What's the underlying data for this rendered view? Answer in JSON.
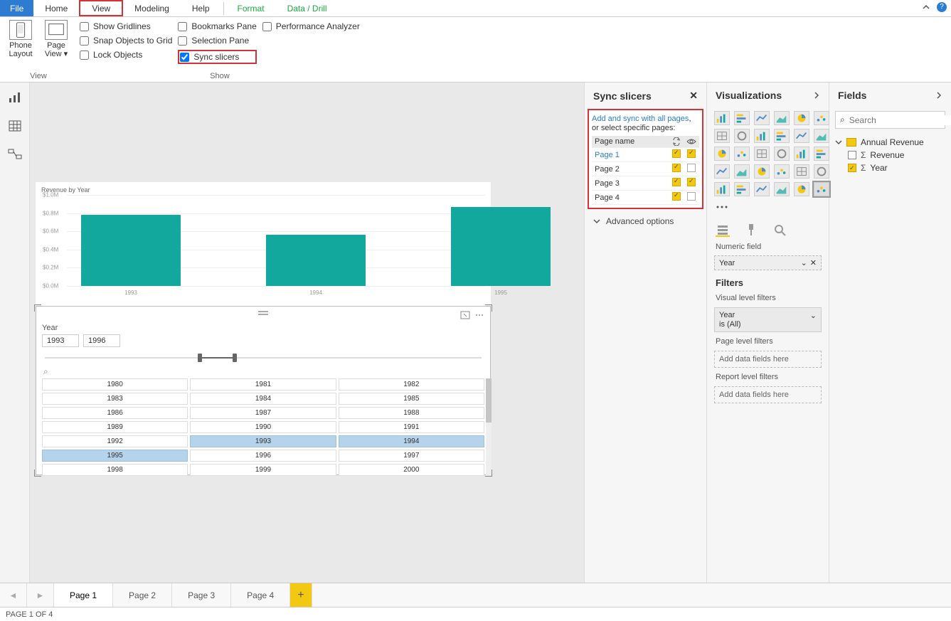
{
  "menu": {
    "file": "File",
    "home": "Home",
    "view": "View",
    "modeling": "Modeling",
    "help": "Help",
    "format": "Format",
    "datadrill": "Data / Drill"
  },
  "ribbon": {
    "view_group": "View",
    "show_group": "Show",
    "phone_layout": "Phone Layout",
    "page_view": "Page View",
    "show_gridlines": "Show Gridlines",
    "snap_to_grid": "Snap Objects to Grid",
    "lock_objects": "Lock Objects",
    "bookmarks_pane": "Bookmarks Pane",
    "selection_pane": "Selection Pane",
    "sync_slicers": "Sync slicers",
    "performance_analyzer": "Performance Analyzer"
  },
  "sync_pane": {
    "title": "Sync slicers",
    "msg1": "Add and sync with all pages",
    "msg1b": ",",
    "msg2": "or select specific pages:",
    "col_page": "Page name",
    "rows": [
      {
        "name": "Page 1",
        "sync": true,
        "visible": true,
        "active": true
      },
      {
        "name": "Page 2",
        "sync": true,
        "visible": false,
        "active": false
      },
      {
        "name": "Page 3",
        "sync": true,
        "visible": true,
        "active": false
      },
      {
        "name": "Page 4",
        "sync": true,
        "visible": false,
        "active": false
      }
    ],
    "advanced": "Advanced options"
  },
  "viz_pane": {
    "title": "Visualizations",
    "numeric_field": "Numeric field",
    "field_value": "Year"
  },
  "filters": {
    "title": "Filters",
    "visual_level": "Visual level filters",
    "card_field": "Year",
    "card_cond": "is (All)",
    "page_level": "Page level filters",
    "report_level": "Report level filters",
    "add_here": "Add data fields here"
  },
  "fields_pane": {
    "title": "Fields",
    "search_ph": "Search",
    "table": "Annual Revenue",
    "cols": [
      {
        "name": "Revenue",
        "checked": false
      },
      {
        "name": "Year",
        "checked": true
      }
    ]
  },
  "slicer": {
    "title": "Year",
    "from": "1993",
    "to": "1996",
    "years": [
      "1980",
      "1981",
      "1982",
      "1983",
      "1984",
      "1985",
      "1986",
      "1987",
      "1988",
      "1989",
      "1990",
      "1991",
      "1992",
      "1993",
      "1994",
      "1995",
      "1996",
      "1997",
      "1998",
      "1999",
      "2000"
    ],
    "selected": [
      "1993",
      "1994",
      "1995"
    ]
  },
  "chart_data": {
    "type": "bar",
    "title": "Revenue by Year",
    "categories": [
      "1993",
      "1994",
      "1995"
    ],
    "values": [
      780000,
      560000,
      870000
    ],
    "ylabel": "",
    "xlabel": "",
    "ylim": [
      0,
      1000000
    ],
    "yticks": [
      "$0.0M",
      "$0.2M",
      "$0.4M",
      "$0.6M",
      "$0.8M",
      "$1.0M"
    ]
  },
  "pages": {
    "tabs": [
      "Page 1",
      "Page 2",
      "Page 3",
      "Page 4"
    ],
    "active": 0,
    "status": "PAGE 1 OF 4"
  }
}
